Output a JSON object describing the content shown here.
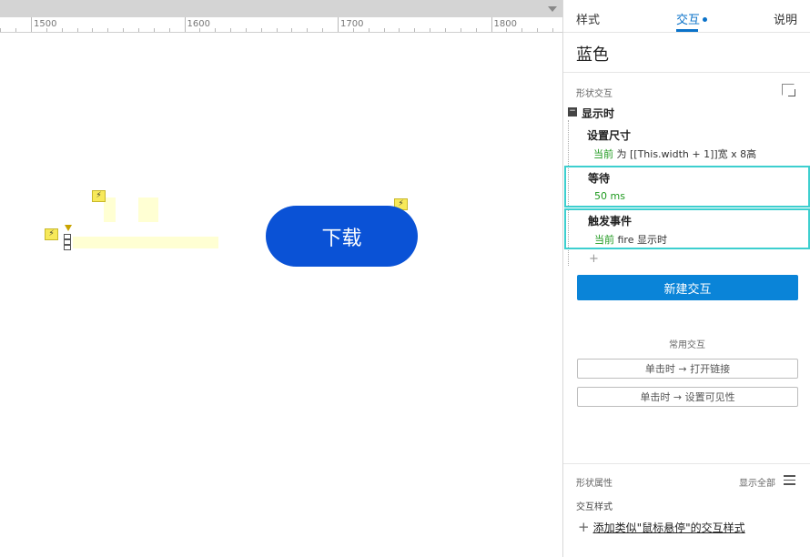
{
  "ruler": {
    "labels": [
      "1500",
      "1600",
      "1700",
      "1800"
    ]
  },
  "canvas": {
    "button_label": "下载",
    "bolt_glyph": "⚡"
  },
  "panel": {
    "tabs": {
      "style": "样式",
      "interaction": "交互",
      "notes": "说明"
    },
    "shape_name": "蓝色",
    "shape_interactions_label": "形状交互",
    "event": {
      "collapse_glyph": "−",
      "name": "显示时"
    },
    "actions": [
      {
        "title": "设置尺寸",
        "target": "当前",
        "detail": "为 [[This.width + 1]]宽 x 8高"
      },
      {
        "title": "等待",
        "target": "50 ms",
        "detail": ""
      },
      {
        "title": "触发事件",
        "target": "当前",
        "detail": "fire 显示时"
      }
    ],
    "add_action_glyph": "+",
    "new_interaction_button": "新建交互",
    "common_label": "常用交互",
    "common_buttons": [
      "单击时 → 打开链接",
      "单击时 → 设置可见性"
    ],
    "properties_label": "形状属性",
    "show_all": "显示全部",
    "interaction_style_label": "交互样式",
    "add_style_plus": "+",
    "add_style_text": "添加类似\"鼠标悬停\"的交互样式"
  },
  "colors": {
    "button_blue": "#0a52d6",
    "accent": "#0a72c9",
    "highlight": "#3dcfcf",
    "target_green": "#1f9a1f"
  }
}
